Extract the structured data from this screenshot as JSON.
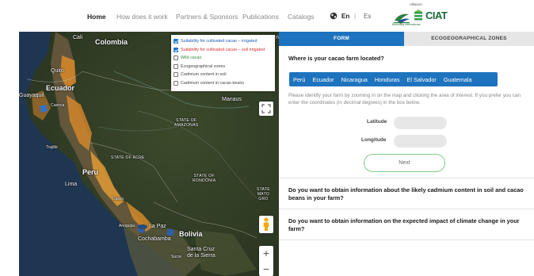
{
  "nav": {
    "links": [
      "Home",
      "How does it work",
      "Partners & Sponsors",
      "Publications",
      "Catalogs"
    ],
    "lang_en": "En",
    "lang_es": "Es",
    "lang_sep": "|",
    "alliance_text": "Alliance",
    "ciat_text": "CIAT",
    "bio_text": "Bioversity International"
  },
  "map": {
    "labels": {
      "cali": "Cali",
      "colombia": "Colombia",
      "quito": "Quito",
      "ecuador": "Ecuador",
      "guayaquil": "Guayaquil",
      "cuenca": "Cuenca",
      "manaus": "Manaus",
      "amazonas": "STATE OF\nAMAZONAS",
      "acre": "STATE OF ACRE",
      "trujillo": "Trujillo",
      "peru": "Peru",
      "lima": "Lima",
      "rondonia": "STATE OF\nRONDÔNIA",
      "matogrosso": "STATE\nMATO\nGRO",
      "cusco": "Cusco",
      "arequipa": "Arequipa",
      "lapaz": "La Paz",
      "bolivia": "Bolivia",
      "cochabamba": "Cochabamba",
      "santacruz": "Santa Cruz\nde la Sierra",
      "sucre": "Sucre",
      "edge_n": "n"
    },
    "layers": [
      {
        "label": "Suitability for cultivated cacao – irrigated",
        "checked": true,
        "color": "#1e5bb8"
      },
      {
        "label": "Suitability for cultivated cacao – soil irrigated",
        "checked": true,
        "color": "#d32f2f"
      },
      {
        "label": "Wild cacao",
        "checked": false,
        "color": "#2e8b3a"
      },
      {
        "label": "Ecogeographical zones",
        "checked": false,
        "color": "#444444"
      },
      {
        "label": "Cadmium content in soil",
        "checked": false,
        "color": "#444444"
      },
      {
        "label": "Cadmium content in cacao beans",
        "checked": false,
        "color": "#444444"
      }
    ],
    "zoom_in": "+",
    "zoom_out": "−"
  },
  "panel": {
    "tab_form": "FORM",
    "tab_eco": "ECOGEOGRAPHICAL ZONES",
    "question1": "Where is your cacao farm located?",
    "countries": [
      "Perú",
      "Ecuador",
      "Nicaragua",
      "Honduras",
      "El Salvador",
      "Guatemala"
    ],
    "instructions": "Please identify your farm by zooming in on the map and clicking the area of interest. If you prefer you can enter the coordinates (in decimal degrees) in the box below.",
    "latitude_label": "Latitude",
    "longitude_label": "Longitude",
    "next": "Next",
    "question2": "Do you want to obtain information about the likely cadmium content in soil and cacao beans in your farm?",
    "question3": "Do you want to obtain information on the expected impact of climate change in your farm?"
  }
}
